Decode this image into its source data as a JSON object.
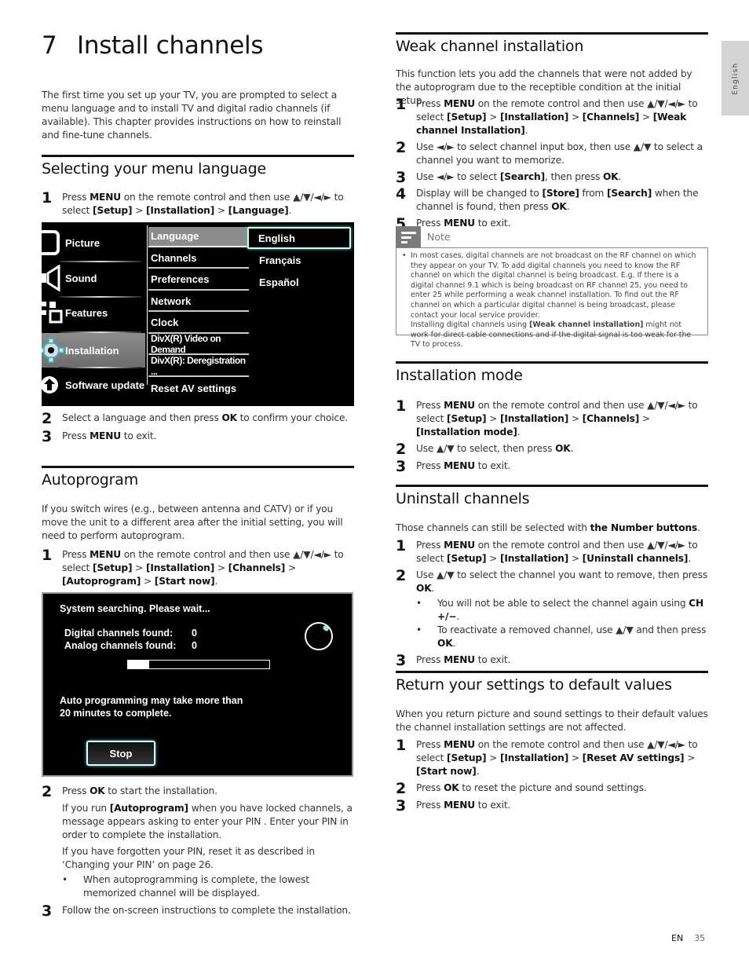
{
  "chapter": {
    "number": "7",
    "title": "Install channels"
  },
  "side_tab": "English",
  "intro": "The first time you set up your TV, you are prompted to select a menu language and to install TV and digital radio channels (if available). This chapter provides instructions on how to reinstall and fine-tune channels.",
  "sections": {
    "menu_language": {
      "title": "Selecting your menu language",
      "steps": [
        {
          "n": "1",
          "html": "Press <b>MENU</b> on the remote control and then use ▲/▼/◄/► to select <b>[Setup]</b> &gt; <b>[Installation]</b> &gt; <b>[Language]</b>."
        },
        {
          "n": "2",
          "html": "Select a language and then press <b>OK</b> to confirm your choice."
        },
        {
          "n": "3",
          "html": "Press <b>MENU</b> to exit."
        }
      ]
    },
    "autoprogram": {
      "title": "Autoprogram",
      "intro": "If you switch wires (e.g., between antenna and CATV) or if you move the unit to a different area after the initial setting, you will need to perform autoprogram.",
      "step1": {
        "n": "1",
        "html": "Press <b>MENU</b> on the remote control and then use ▲/▼/◄/► to select <b>[Setup]</b> &gt; <b>[Installation]</b> &gt; <b>[Channels]</b> &gt; <b>[Autoprogram]</b> &gt; <b>[Start now]</b>."
      },
      "step2": {
        "n": "2",
        "html": "Press <b>OK</b> to start the installation."
      },
      "step2_p1": "If you run <b>[Autoprogram]</b> when you have locked channels, a message appears asking to enter your PIN . Enter your PIN in order to complete the installation.",
      "step2_p2": "If you have forgotten your PIN, reset it as described in ‘Changing your PIN’ on page 26.",
      "step2_bullet": "When autoprogramming is complete, the lowest memorized channel will be displayed.",
      "step3": {
        "n": "3",
        "html": "Follow the on-screen instructions to complete the installation."
      }
    },
    "weak_channel": {
      "title": "Weak channel installation",
      "intro": "This function lets you add the channels that were not added by the autoprogram due to the receptible condition at the initial setup.",
      "steps": [
        {
          "n": "1",
          "html": "Press <b>MENU</b> on the remote control and then use ▲/▼/◄/► to select <b>[Setup]</b> &gt; <b>[Installation]</b> &gt; <b>[Channels]</b> &gt; <b>[Weak channel Installation]</b>."
        },
        {
          "n": "2",
          "html": "Use ◄/► to select channel input box, then use ▲/▼ to select a channel you want to memorize."
        },
        {
          "n": "3",
          "html": "Use ◄/► to select <b>[Search]</b>, then press <b>OK</b>."
        },
        {
          "n": "4",
          "html": "Display will be changed to <b>[Store]</b> from <b>[Search]</b> when the channel is found, then press <b>OK</b>."
        },
        {
          "n": "5",
          "html": "Press <b>MENU</b> to exit."
        }
      ],
      "note_label": "Note",
      "note_html": "In most cases, digital channels are not broadcast on the RF channel on which they appear on your TV. To add digital channels you need to know the RF channel on which the digital channel is being broadcast. E.g. If there is a digital channel 9.1 which is being broadcast on RF channel 25, you need to enter 25 while performing a weak channel installation. To find out the RF channel on which a particular digital channel is being broadcast, please contact your local service provider.<br>Installing digital channels using <b>[Weak channel installation]</b> might not work for direct cable connections and if the digital signal is too weak for the TV to process."
    },
    "installation_mode": {
      "title": "Installation mode",
      "steps": [
        {
          "n": "1",
          "html": "Press <b>MENU</b> on the remote control and then use ▲/▼/◄/► to select <b>[Setup]</b> &gt; <b>[Installation]</b> &gt; <b>[Channels]</b> &gt; <b>[Installation mode]</b>."
        },
        {
          "n": "2",
          "html": "Use ▲/▼ to select, then press <b>OK</b>."
        },
        {
          "n": "3",
          "html": "Press <b>MENU</b> to exit."
        }
      ]
    },
    "uninstall": {
      "title": "Uninstall channels",
      "intro": "Those channels can still be selected with <b>the Number buttons</b>.",
      "step1": {
        "n": "1",
        "html": "Press <b>MENU</b> on the remote control and then use ▲/▼/◄/► to select <b>[Setup]</b> &gt; <b>[Installation]</b> &gt; <b>[Uninstall channels]</b>."
      },
      "step2": {
        "n": "2",
        "html": "Use ▲/▼ to select the channel you want to remove, then press <b>OK</b>."
      },
      "bullets": [
        "You will not be able to select the channel again using <b>CH +/−</b>.",
        "To reactivate a removed channel, use ▲/▼ and then press <b>OK</b>."
      ],
      "step3": {
        "n": "3",
        "html": "Press <b>MENU</b> to exit."
      }
    },
    "defaults": {
      "title": "Return your settings to default values",
      "intro": "When you return picture and sound settings to their default values the channel installation settings are not affected.",
      "steps": [
        {
          "n": "1",
          "html": "Press <b>MENU</b> on the remote control and then use ▲/▼/◄/► to select <b>[Setup]</b> &gt; <b>[Installation]</b> &gt; <b>[Reset AV settings]</b> &gt; <b>[Start now]</b>."
        },
        {
          "n": "2",
          "html": "Press <b>OK</b> to reset the picture and sound settings."
        },
        {
          "n": "3",
          "html": "Press <b>MENU</b> to exit."
        }
      ]
    }
  },
  "tv_menu": {
    "main": [
      {
        "label": "Picture",
        "icon": "picture-icon"
      },
      {
        "label": "Sound",
        "icon": "speaker-icon"
      },
      {
        "label": "Features",
        "icon": "features-icon"
      },
      {
        "label": "Installation",
        "icon": "gear-icon",
        "selected": true
      },
      {
        "label": "Software update",
        "icon": "upload-icon"
      }
    ],
    "sub": [
      "Language",
      "Channels",
      "Preferences",
      "Network",
      "Clock",
      "DivX(R) Video on Demand",
      "DivX(R): Deregistration ...",
      "Reset AV settings"
    ],
    "sub_selected": "Language",
    "options": [
      "English",
      "Français",
      "Español"
    ],
    "option_selected": "English"
  },
  "autoprogram_dialog": {
    "status": "System searching. Please wait...",
    "digital_label": "Digital channels found:",
    "digital_value": "0",
    "analog_label": "Analog channels found:",
    "analog_value": "0",
    "progress_percent": 15,
    "message_line1": "Auto programming may take more than",
    "message_line2": "20 minutes to complete.",
    "stop_label": "Stop"
  },
  "footer": {
    "lang": "EN",
    "page": "35"
  }
}
